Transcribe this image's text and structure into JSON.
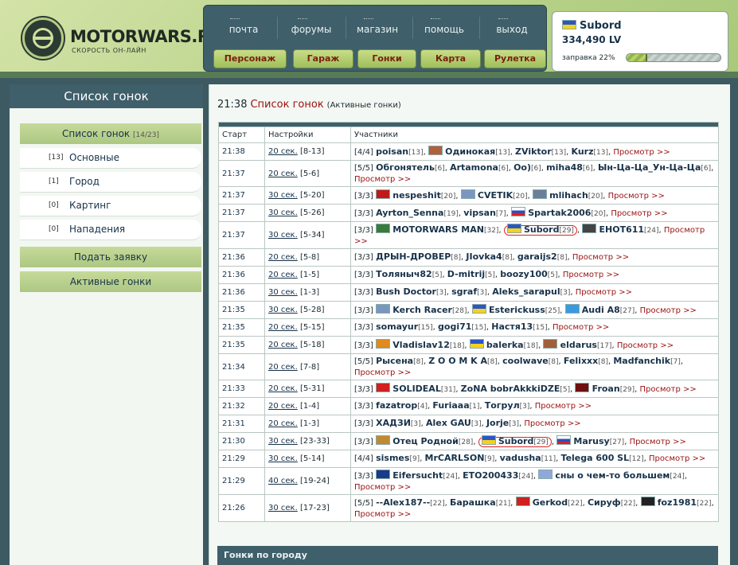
{
  "header": {
    "logo_text": "MOTORWARS.RU",
    "logo_sub": "СКОРОСТЬ ОН-ЛАЙН",
    "nav_links": [
      "почта",
      "форумы",
      "магазин",
      "помощь",
      "выход"
    ],
    "nav_buttons": [
      "Персонаж",
      "Гараж",
      "Гонки",
      "Карта",
      "Рулетка"
    ]
  },
  "user": {
    "name": "Subord",
    "money": "334,490 LV",
    "fuel_label": "заправка 22%",
    "fuel_percent": 22
  },
  "sidebar": {
    "title": "Список гонок",
    "active_head": "Список гонок",
    "active_count": "[14/23]",
    "items": [
      {
        "count": "[13]",
        "label": "Основные"
      },
      {
        "count": "[1]",
        "label": "Город"
      },
      {
        "count": "[0]",
        "label": "Картинг"
      },
      {
        "count": "[0]",
        "label": "Нападения"
      }
    ],
    "submit_label": "Подать заявку",
    "active_races_label": "Активные гонки"
  },
  "main": {
    "time": "21:38",
    "title": "Список гонок",
    "subtitle": "(Активные гонки)",
    "headers": [
      "Старт",
      "Настройки",
      "Участники"
    ],
    "view_label": "Просмотр >>",
    "footer": "Гонки по городу",
    "rows": [
      {
        "time": "21:38",
        "dur": "20 сек.",
        "range": "[8-13]",
        "count": "[4/4]",
        "players": [
          {
            "n": "poisan",
            "l": "[13]"
          },
          {
            "n": "Одинокая",
            "l": "[13]",
            "av": "#b0603a"
          },
          {
            "n": "ZViktor",
            "l": "[13]"
          },
          {
            "n": "Kurz",
            "l": "[13]"
          }
        ]
      },
      {
        "time": "21:37",
        "dur": "20 сек.",
        "range": "[5-6]",
        "count": "[5/5]",
        "players": [
          {
            "n": "Обгонятель",
            "l": "[6]"
          },
          {
            "n": "Artamona",
            "l": "[6]"
          },
          {
            "n": "Oo)",
            "l": "[6]"
          },
          {
            "n": "miha48",
            "l": "[6]"
          },
          {
            "n": "Ын-Ца-Ца_Ун-Ца-Ца",
            "l": "[6]"
          }
        ]
      },
      {
        "time": "21:37",
        "dur": "30 сек.",
        "range": "[5-20]",
        "count": "[3/3]",
        "players": [
          {
            "n": "nespeshit",
            "l": "[20]",
            "av": "#c41818"
          },
          {
            "n": "CVETIK",
            "l": "[20]",
            "av": "#7a96c0"
          },
          {
            "n": "mlihach",
            "l": "[20]",
            "av": "#6a7f9a"
          }
        ]
      },
      {
        "time": "21:37",
        "dur": "30 сек.",
        "range": "[5-26]",
        "count": "[3/3]",
        "players": [
          {
            "n": "Ayrton_Senna",
            "l": "[19]"
          },
          {
            "n": "vipsan",
            "l": "[7]"
          },
          {
            "n": "Spartak2006",
            "l": "[20]",
            "flag": "ru"
          }
        ]
      },
      {
        "time": "21:37",
        "dur": "30 сек.",
        "range": "[5-34]",
        "count": "[3/3]",
        "players": [
          {
            "n": "MOTORWARS MAN",
            "l": "[32]",
            "av": "#3a7a3a"
          },
          {
            "n": "Subord",
            "l": "[29]",
            "flag": "ua",
            "circ": true
          },
          {
            "n": "EHOT611",
            "l": "[24]",
            "av": "#444444"
          }
        ]
      },
      {
        "time": "21:36",
        "dur": "20 сек.",
        "range": "[5-8]",
        "count": "[3/3]",
        "players": [
          {
            "n": "ДРЫН-ДРОВЕР",
            "l": "[8]"
          },
          {
            "n": "JIovka4",
            "l": "[8]"
          },
          {
            "n": "garaijs2",
            "l": "[8]"
          }
        ]
      },
      {
        "time": "21:36",
        "dur": "20 сек.",
        "range": "[1-5]",
        "count": "[3/3]",
        "players": [
          {
            "n": "Толяныч82",
            "l": "[5]"
          },
          {
            "n": "D-mitrij",
            "l": "[5]"
          },
          {
            "n": "boozy100",
            "l": "[5]"
          }
        ]
      },
      {
        "time": "21:36",
        "dur": "30 сек.",
        "range": "[1-3]",
        "count": "[3/3]",
        "players": [
          {
            "n": "Bush Doctor",
            "l": "[3]"
          },
          {
            "n": "sgraf",
            "l": "[3]"
          },
          {
            "n": "Aleks_sarapul",
            "l": "[3]"
          }
        ]
      },
      {
        "time": "21:35",
        "dur": "30 сек.",
        "range": "[5-28]",
        "count": "[3/3]",
        "players": [
          {
            "n": "Kerch Racer",
            "l": "[28]",
            "av": "#7a96c0"
          },
          {
            "n": "Esterickuss",
            "l": "[25]",
            "flag": "ua"
          },
          {
            "n": "Audi A8",
            "l": "[27]",
            "av": "#3a9ae0"
          }
        ]
      },
      {
        "time": "21:35",
        "dur": "20 сек.",
        "range": "[5-15]",
        "count": "[3/3]",
        "players": [
          {
            "n": "somayur",
            "l": "[15]"
          },
          {
            "n": "gogi71",
            "l": "[15]"
          },
          {
            "n": "Настя13",
            "l": "[15]"
          }
        ]
      },
      {
        "time": "21:35",
        "dur": "20 сек.",
        "range": "[5-18]",
        "count": "[3/3]",
        "players": [
          {
            "n": "Vladislav12",
            "l": "[18]",
            "av": "#e08a20"
          },
          {
            "n": "balerka",
            "l": "[18]",
            "flag": "ua"
          },
          {
            "n": "eldarus",
            "l": "[17]",
            "av": "#a0603a"
          }
        ]
      },
      {
        "time": "21:34",
        "dur": "20 сек.",
        "range": "[7-8]",
        "count": "[5/5]",
        "players": [
          {
            "n": "Рысена",
            "l": "[8]"
          },
          {
            "n": "Z O O M K A",
            "l": "[8]"
          },
          {
            "n": "coolwave",
            "l": "[8]"
          },
          {
            "n": "Felixxx",
            "l": "[8]"
          },
          {
            "n": "Madfanchik",
            "l": "[7]"
          }
        ]
      },
      {
        "time": "21:33",
        "dur": "20 сек.",
        "range": "[5-31]",
        "count": "[3/3]",
        "players": [
          {
            "n": "SOLIDEAL",
            "l": "[31]",
            "av": "#d02020"
          },
          {
            "n": "ZoNA bobrAkkkiDZE",
            "l": "[5]"
          },
          {
            "n": "Froan",
            "l": "[29]",
            "av": "#701010"
          }
        ]
      },
      {
        "time": "21:32",
        "dur": "20 сек.",
        "range": "[1-4]",
        "count": "[3/3]",
        "players": [
          {
            "n": "fazatrop",
            "l": "[4]"
          },
          {
            "n": "Furiaaa",
            "l": "[1]"
          },
          {
            "n": "Тогрул",
            "l": "[3]"
          }
        ]
      },
      {
        "time": "21:31",
        "dur": "20 сек.",
        "range": "[1-3]",
        "count": "[3/3]",
        "players": [
          {
            "n": "ХАДЗИ",
            "l": "[3]"
          },
          {
            "n": "Alex GAU",
            "l": "[3]"
          },
          {
            "n": "Jorje",
            "l": "[3]"
          }
        ]
      },
      {
        "time": "21:30",
        "dur": "30 сек.",
        "range": "[23-33]",
        "count": "[3/3]",
        "players": [
          {
            "n": "Отец Родной",
            "l": "[28]",
            "av": "#c08a30"
          },
          {
            "n": "Subord",
            "l": "[29]",
            "flag": "ua",
            "circ": true
          },
          {
            "n": "Marusy",
            "l": "[27]",
            "flag": "ru"
          }
        ]
      },
      {
        "time": "21:29",
        "dur": "30 сек.",
        "range": "[5-14]",
        "count": "[4/4]",
        "players": [
          {
            "n": "sismes",
            "l": "[9]"
          },
          {
            "n": "MrCARLSON",
            "l": "[9]"
          },
          {
            "n": "vadusha",
            "l": "[11]"
          },
          {
            "n": "Telega 600 SL",
            "l": "[12]"
          }
        ]
      },
      {
        "time": "21:29",
        "dur": "40 сек.",
        "range": "[19-24]",
        "count": "[3/3]",
        "players": [
          {
            "n": "Eifersucht",
            "l": "[24]",
            "av": "#1a3a8a"
          },
          {
            "n": "ETO200433",
            "l": "[24]"
          },
          {
            "n": "сны о чем-то большем",
            "l": "[24]",
            "av": "#90a8d8"
          }
        ]
      },
      {
        "time": "21:26",
        "dur": "30 сек.",
        "range": "[17-23]",
        "count": "[5/5]",
        "players": [
          {
            "n": "--Alex187--",
            "l": "[22]"
          },
          {
            "n": "Барашка",
            "l": "[21]"
          },
          {
            "n": "Gerkod",
            "l": "[22]",
            "av": "#d02020"
          },
          {
            "n": "Сируф",
            "l": "[22]"
          },
          {
            "n": "foz1981",
            "l": "[22]",
            "av": "#222222"
          }
        ]
      }
    ]
  }
}
